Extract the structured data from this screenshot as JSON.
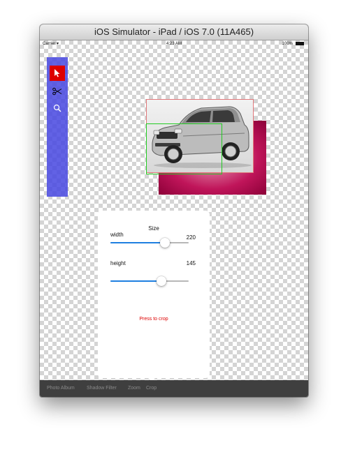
{
  "window": {
    "title": "iOS Simulator - iPad / iOS 7.0 (11A465)"
  },
  "status": {
    "carrier": "Carrier",
    "time": "4:23 AM",
    "battery": "100%"
  },
  "tools": [
    {
      "name": "pointer",
      "icon": "pointer-icon",
      "active": true
    },
    {
      "name": "scissors",
      "icon": "scissors-icon",
      "active": false
    },
    {
      "name": "zoom",
      "icon": "magnifier-icon",
      "active": false
    }
  ],
  "popover": {
    "title": "Size",
    "width_label": "width",
    "width_value": "220",
    "width_fraction": 0.7,
    "height_label": "height",
    "height_value": "145",
    "height_fraction": 0.65,
    "crop_label": "Press to crop"
  },
  "tabbar": {
    "items": [
      "Photo Album",
      "Shadow Filter",
      "Zoom",
      "Crop"
    ]
  },
  "colors": {
    "accent": "#1e7fe0",
    "tool_active": "#dd0000",
    "toolbar": "#4646e1",
    "crop_text": "#dd0000"
  }
}
